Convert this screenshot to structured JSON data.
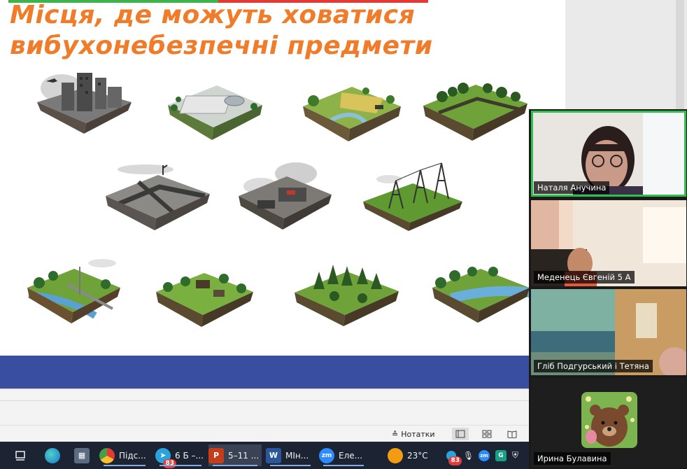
{
  "slide": {
    "title_line1": "Місця, де можуть ховатися",
    "title_line2": "вибухонебезпечні предмети"
  },
  "statusbar": {
    "notes_label": "Нотатки"
  },
  "taskbar": {
    "items": [
      {
        "label": "Підс...",
        "icon": "chrome-icon"
      },
      {
        "label": "6 Б –...",
        "icon": "telegram-icon",
        "badge": "83"
      },
      {
        "label": "5–11 ...",
        "icon": "powerpoint-icon"
      },
      {
        "label": "МІн...",
        "icon": "word-icon"
      },
      {
        "label": "Еле...",
        "icon": "zoom-icon"
      }
    ],
    "weather": "23°C",
    "tray_badge": "83"
  },
  "participants": [
    {
      "name": "Наталя Анучина",
      "active": true
    },
    {
      "name": "Меденець Євгеній 5 А",
      "active": false
    },
    {
      "name": "Гліб Подгурський і Тетяна",
      "active": false
    },
    {
      "name": "Ирина Булавина",
      "active": false
    }
  ],
  "colors": {
    "title": "#f07c2a",
    "band": "#3a4ea0",
    "active_speaker": "#2fbf4f"
  }
}
